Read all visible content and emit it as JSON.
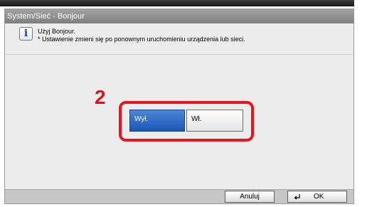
{
  "window": {
    "title": "System/Sieć - Bonjour"
  },
  "message": {
    "icon": "info-icon",
    "line1": "Użyj Bonjour.",
    "line2": "* Ustawienie zmieni się po ponownym uruchomieniu urządzenia lub sieci."
  },
  "annotation": {
    "step_number": "2"
  },
  "options": {
    "off_label": "Wył.",
    "on_label": "Wł.",
    "selected": "Wył."
  },
  "footer": {
    "cancel_label": "Anuluj",
    "ok_label": "OK",
    "ok_icon": "enter-icon"
  },
  "colors": {
    "highlight": "#e3171d",
    "selected_option": "#1e56b4",
    "titlebar": "#8c8c8c"
  }
}
